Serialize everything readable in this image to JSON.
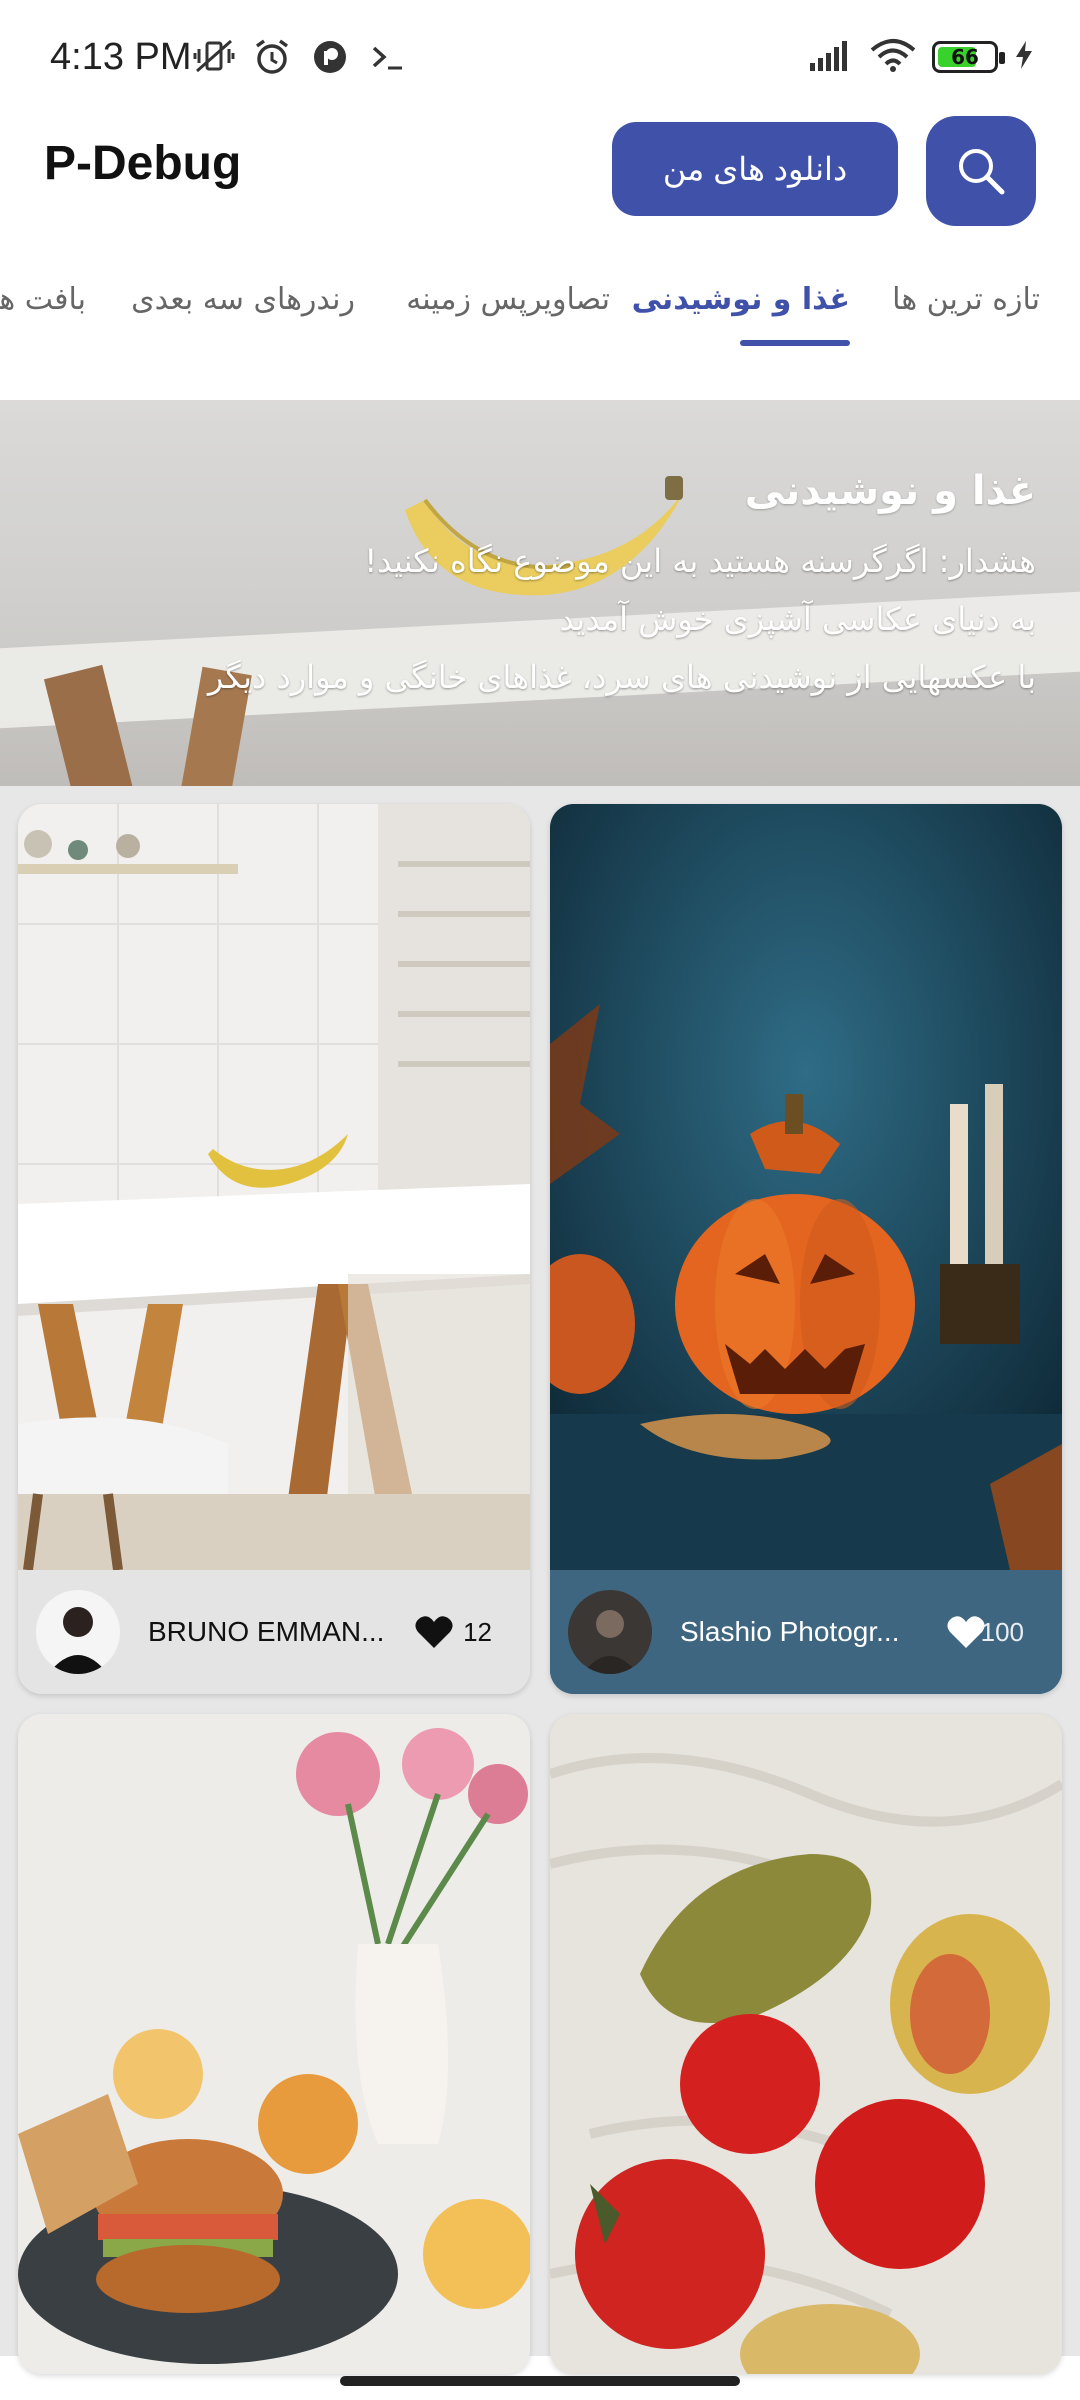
{
  "status_bar": {
    "time": "4:13 PM",
    "icons_left": [
      "mute-vibrate-icon",
      "alarm-icon",
      "app-notification-icon",
      "terminal-icon"
    ],
    "signal": "signal-icon",
    "wifi": "wifi-icon",
    "battery_level": "66",
    "charging": "charging-icon",
    "battery_color": "#39d12b"
  },
  "app": {
    "title": "P-Debug",
    "downloads_label": "دانلود های من",
    "accent": "#3f51a8"
  },
  "tabs": [
    {
      "label": "تازه ترین ها",
      "active": false
    },
    {
      "label": "غذا و نوشیدنی",
      "active": true
    },
    {
      "label": "تصاویرپس زمینه",
      "active": false
    },
    {
      "label": "رندرهای سه بعدی",
      "active": false
    },
    {
      "label": "بافت ها",
      "active": false
    }
  ],
  "hero": {
    "title": "غذا و نوشیدنی",
    "lines": [
      "هشدار:  اگرگرسنه هستید به این موضوع نگاه نکنید!",
      "به دنیای عکاسی آشپزی خوش آمدید",
      "با عکسهایی از نوشیدنی های سرد، غذاهای خانگی و موارد دیگر"
    ]
  },
  "cards": [
    {
      "author": "BRUNO EMMAN...",
      "likes": "12",
      "liked": true,
      "footer_color": "#e4e4e4",
      "text_color": "#111111"
    },
    {
      "author": "Slashio Photogr...",
      "likes": "100",
      "liked": false,
      "footer_color": "#3e6681",
      "text_color": "#ffffff"
    },
    {
      "author": "",
      "likes": "",
      "liked": false,
      "footer_color": "#f0eeea",
      "text_color": "#111111"
    },
    {
      "author": "",
      "likes": "",
      "liked": false,
      "footer_color": "#e9e6e1",
      "text_color": "#111111"
    }
  ]
}
